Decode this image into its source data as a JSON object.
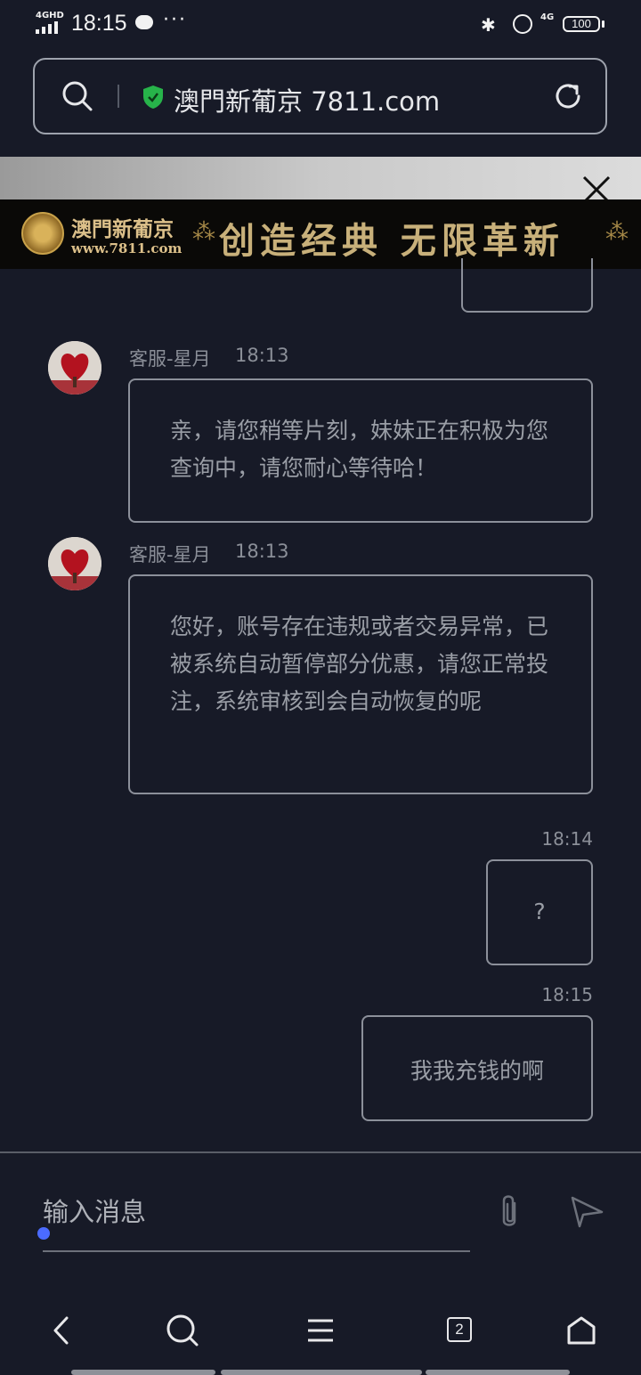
{
  "status_bar": {
    "time": "18:15",
    "network": "4GHD",
    "network_right": "4G",
    "battery": "100",
    "more": "···"
  },
  "address_bar": {
    "url": "澳門新葡京 7811.com",
    "icons": [
      "search-icon",
      "shield-icon",
      "reload-icon"
    ]
  },
  "banner": {
    "brand": "澳門新葡京",
    "site": "www.7811.com",
    "slogan": "创造经典 无限革新",
    "colors": {
      "gold": "#dcc08a",
      "background": "#0a0907"
    }
  },
  "messages": [
    {
      "sender": "客服-星月",
      "time": "18:13",
      "text": "亲，请您稍等片刻，妹妹正在积极为您查询中，请您耐心等待哈！"
    },
    {
      "sender": "客服-星月",
      "time": "18:13",
      "text": "您好，账号存在违规或者交易异常，已被系统自动暂停部分优惠，请您正常投注，系统审核到会自动恢复的呢"
    },
    {
      "sender": "user",
      "time": "18:14",
      "text": "?"
    },
    {
      "sender": "user",
      "time": "18:15",
      "text": "我我充钱的啊"
    }
  ],
  "input": {
    "placeholder": "输入消息",
    "icons": [
      "attachment-icon",
      "send-icon"
    ]
  },
  "bottom_nav": {
    "tab_count": "2",
    "icons": [
      "back-icon",
      "search-icon",
      "menu-icon",
      "tabs-icon",
      "home-icon"
    ]
  },
  "colors": {
    "background": "#171a27",
    "bubble_border": "#8c909a",
    "cursor_dot": "#4b6bff",
    "secure_shield": "#27b34a"
  }
}
